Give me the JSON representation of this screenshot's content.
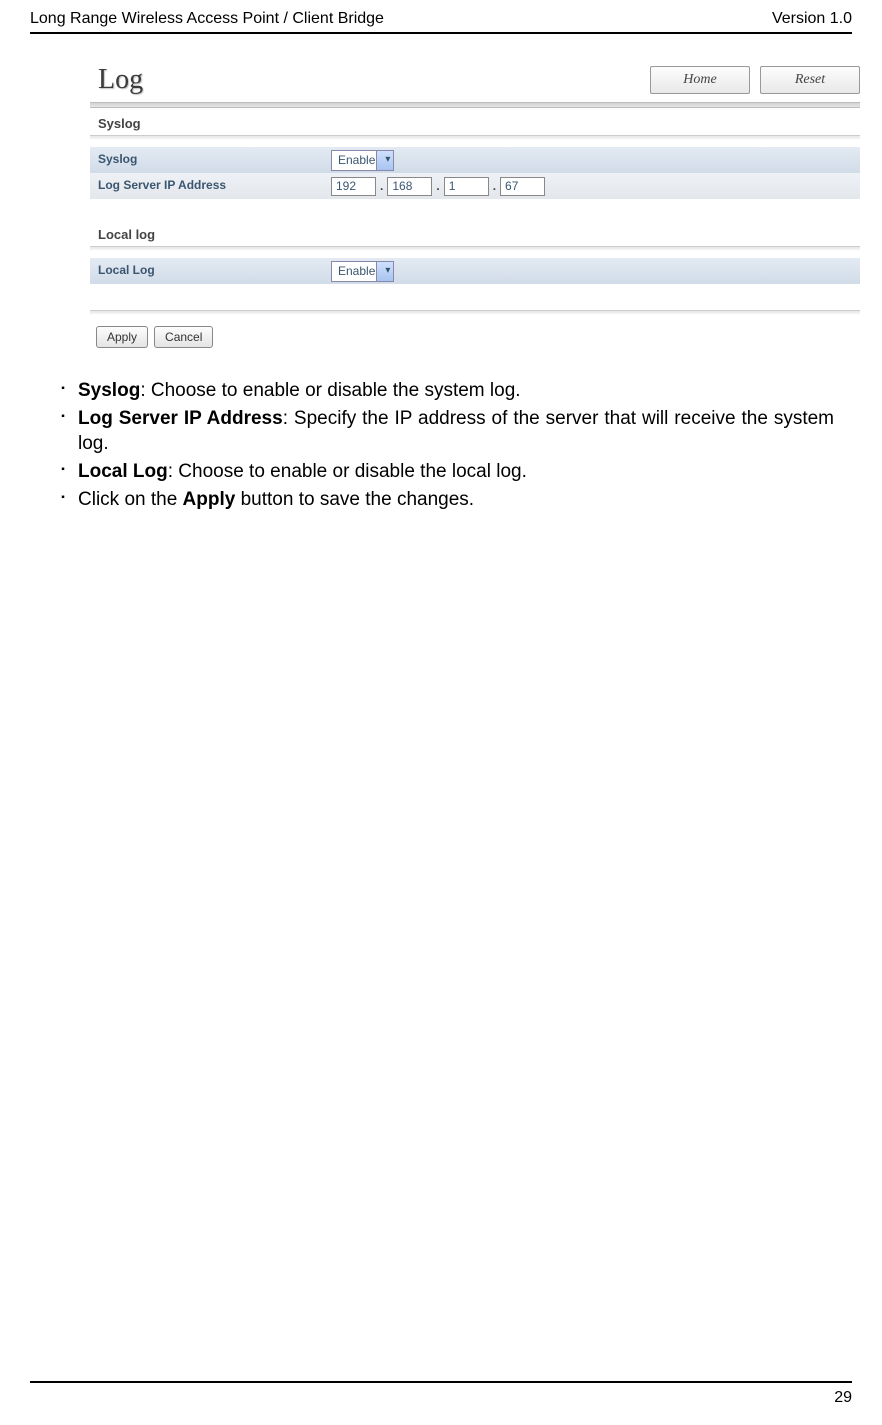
{
  "header": {
    "left": "Long Range Wireless Access Point / Client Bridge",
    "right": "Version 1.0"
  },
  "panel": {
    "title": "Log",
    "nav": {
      "home": "Home",
      "reset": "Reset"
    },
    "syslog_section": "Syslog",
    "syslog_label": "Syslog",
    "syslog_value": "Enable",
    "logserver_label": "Log Server IP Address",
    "ip": {
      "a": "192",
      "b": "168",
      "c": "1",
      "d": "67"
    },
    "locallog_section": "Local log",
    "locallog_label": "Local Log",
    "locallog_value": "Enable",
    "apply": "Apply",
    "cancel": "Cancel"
  },
  "bullets": {
    "b1_bold": "Syslog",
    "b1_rest": ": Choose to enable or disable the system log.",
    "b2_bold": "Log Server IP Address",
    "b2_rest": ": Specify the IP address of the server that will receive the system log.",
    "b3_bold": "Local Log",
    "b3_rest": ": Choose to enable or disable the local log.",
    "b4_pre": "Click on the ",
    "b4_bold": "Apply",
    "b4_post": " button to save the changes."
  },
  "page_number": "29"
}
